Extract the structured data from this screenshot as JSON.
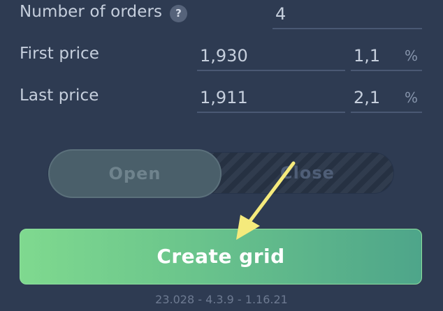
{
  "form": {
    "orders_label": "Number of orders",
    "orders_help_icon": "?",
    "orders_value": "4",
    "first_price_label": "First price",
    "first_price_value": "1,930",
    "first_pct_value": "1,1",
    "last_price_label": "Last price",
    "last_price_value": "1,911",
    "last_pct_value": "2,1",
    "pct_unit": "%"
  },
  "toggle": {
    "open_label": "Open",
    "close_label": "Close",
    "selected": "Open"
  },
  "actions": {
    "create_label": "Create grid"
  },
  "footer": {
    "version": "23.028 - 4.3.9 - 1.16.21"
  },
  "colors": {
    "background": "#2e3b52",
    "accent_green": "#6cc68c",
    "annotation_arrow": "#f5ea7c"
  }
}
